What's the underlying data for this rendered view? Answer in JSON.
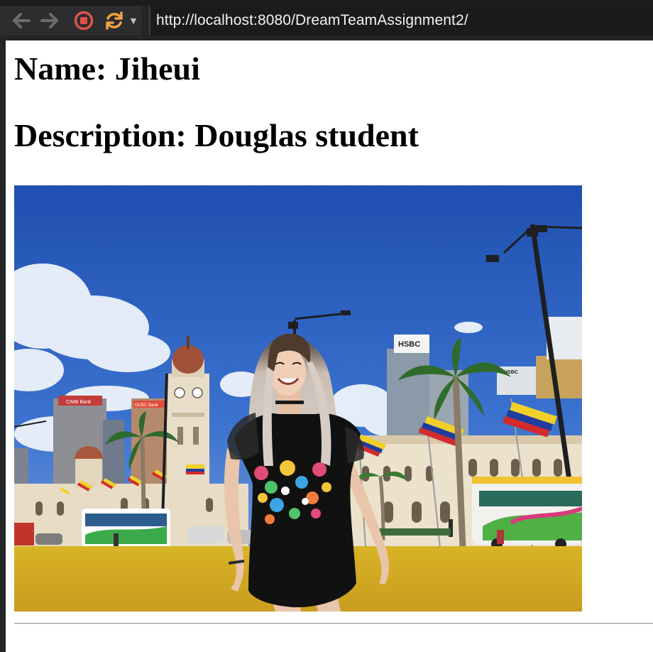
{
  "browser": {
    "url": "http://localhost:8080/DreamTeamAssignment2/",
    "icons": {
      "back": "arrow-left-icon",
      "forward": "arrow-right-icon",
      "stop": "stop-icon",
      "reload": "reload-icon",
      "reload_menu": "chevron-down-icon"
    },
    "colors": {
      "stop": "#e0524a",
      "reload": "#f2a23c",
      "nav_disabled": "#6a6c6e"
    }
  },
  "page": {
    "name": "Name: Jiheui",
    "description": "Description: Douglas student"
  },
  "photo": {
    "subject": "profile-photo",
    "signs": {
      "hsbc_top": "HSBC",
      "hsbc_side": "HSBC",
      "cimb": "CIMB Bank",
      "ocbc": "OCBC Bank"
    }
  }
}
